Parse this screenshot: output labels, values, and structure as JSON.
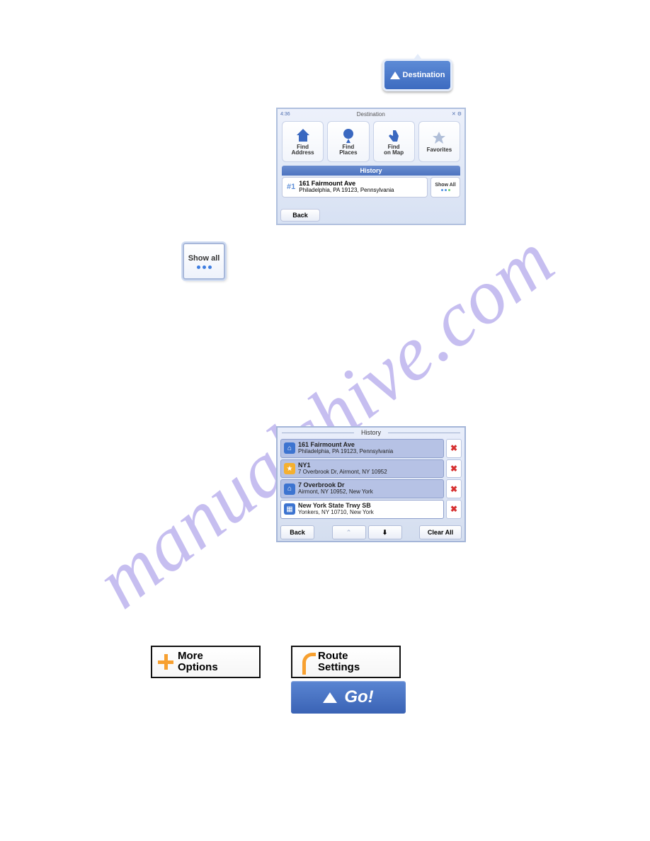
{
  "watermark": "manualshive.com",
  "dest_button": {
    "label": "Destination"
  },
  "dest_screen": {
    "time": "4:36",
    "title": "Destination",
    "buttons": [
      {
        "label": "Find\nAddress"
      },
      {
        "label": "Find\nPlaces"
      },
      {
        "label": "Find\non Map"
      },
      {
        "label": "Favorites"
      }
    ],
    "history_label": "History",
    "history_item": {
      "num": "#1",
      "line1": "161 Fairmount Ave",
      "line2": "Philadelphia, PA 19123, Pennsylvania"
    },
    "show_all": "Show All",
    "back": "Back"
  },
  "showall_tile": "Show all",
  "history_screen": {
    "title": "History",
    "items": [
      {
        "line1": "161 Fairmount Ave",
        "line2": "Philadelphia, PA 19123, Pennsylvania",
        "icon": "home",
        "bg": "blue"
      },
      {
        "line1": "NY1",
        "line2": "7 Overbrook Dr, Airmont, NY 10952",
        "icon": "star",
        "bg": "blue"
      },
      {
        "line1": "7 Overbrook Dr",
        "line2": "Airmont, NY 10952, New York",
        "icon": "home",
        "bg": "blue"
      },
      {
        "line1": "New York State Trwy SB",
        "line2": "Yonkers, NY 10710, New York",
        "icon": "road",
        "bg": "plain"
      }
    ],
    "back": "Back",
    "clear_all": "Clear All"
  },
  "more_options": "More\nOptions",
  "route_settings": "Route\nSettings",
  "go": "Go!"
}
